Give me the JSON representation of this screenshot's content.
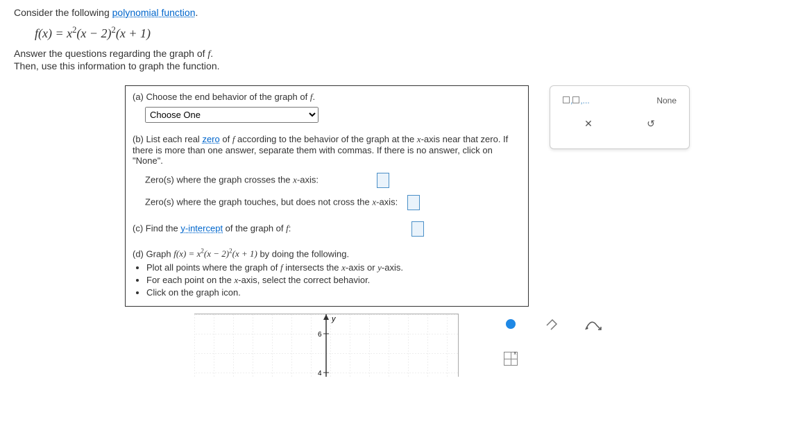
{
  "intro": {
    "prefix": "Consider the following ",
    "link": "polynomial function",
    "suffix": "."
  },
  "instructions": {
    "line1_a": "Answer the questions regarding the graph of ",
    "line1_f": "f",
    "line1_b": ".",
    "line2": "Then, use this information to graph the function."
  },
  "parts": {
    "a": {
      "text_a": "(a) Choose the end behavior of the graph of ",
      "text_f": "f",
      "text_b": ".",
      "select_placeholder": "Choose One"
    },
    "b": {
      "text_a": "(b) List each real ",
      "link": "zero",
      "text_b": " of ",
      "text_f": "f",
      "text_c": " according to the behavior of the graph at the ",
      "text_x": "x",
      "text_d": "-axis near that zero. If there is more than one answer, separate them with commas. If there is no answer, click on \"None\".",
      "crosses_a": "Zero(s) where the graph crosses the ",
      "crosses_x": "x",
      "crosses_b": "-axis:",
      "touches_a": "Zero(s) where the graph touches, but does not cross the ",
      "touches_x": "x",
      "touches_b": "-axis:"
    },
    "c": {
      "text_a": "(c) Find the ",
      "link": "y-intercept",
      "text_b": " of the graph of ",
      "text_f": "f",
      "text_c": ":"
    },
    "d": {
      "text_a": "(d) Graph ",
      "text_b": " by doing the following.",
      "b1_a": "Plot all points where the graph of ",
      "b1_f": "f",
      "b1_b": " intersects the ",
      "b1_x": "x",
      "b1_c": "-axis or ",
      "b1_y": "y",
      "b1_d": "-axis.",
      "b2_a": "For each point on the ",
      "b2_x": "x",
      "b2_b": "-axis, select the correct behavior.",
      "b3": "Click on the graph icon."
    }
  },
  "sidepanel": {
    "list_hint": "□,□,...",
    "none": "None"
  },
  "graph": {
    "ylabel": "y",
    "tick6": "6",
    "tick4": "4"
  }
}
